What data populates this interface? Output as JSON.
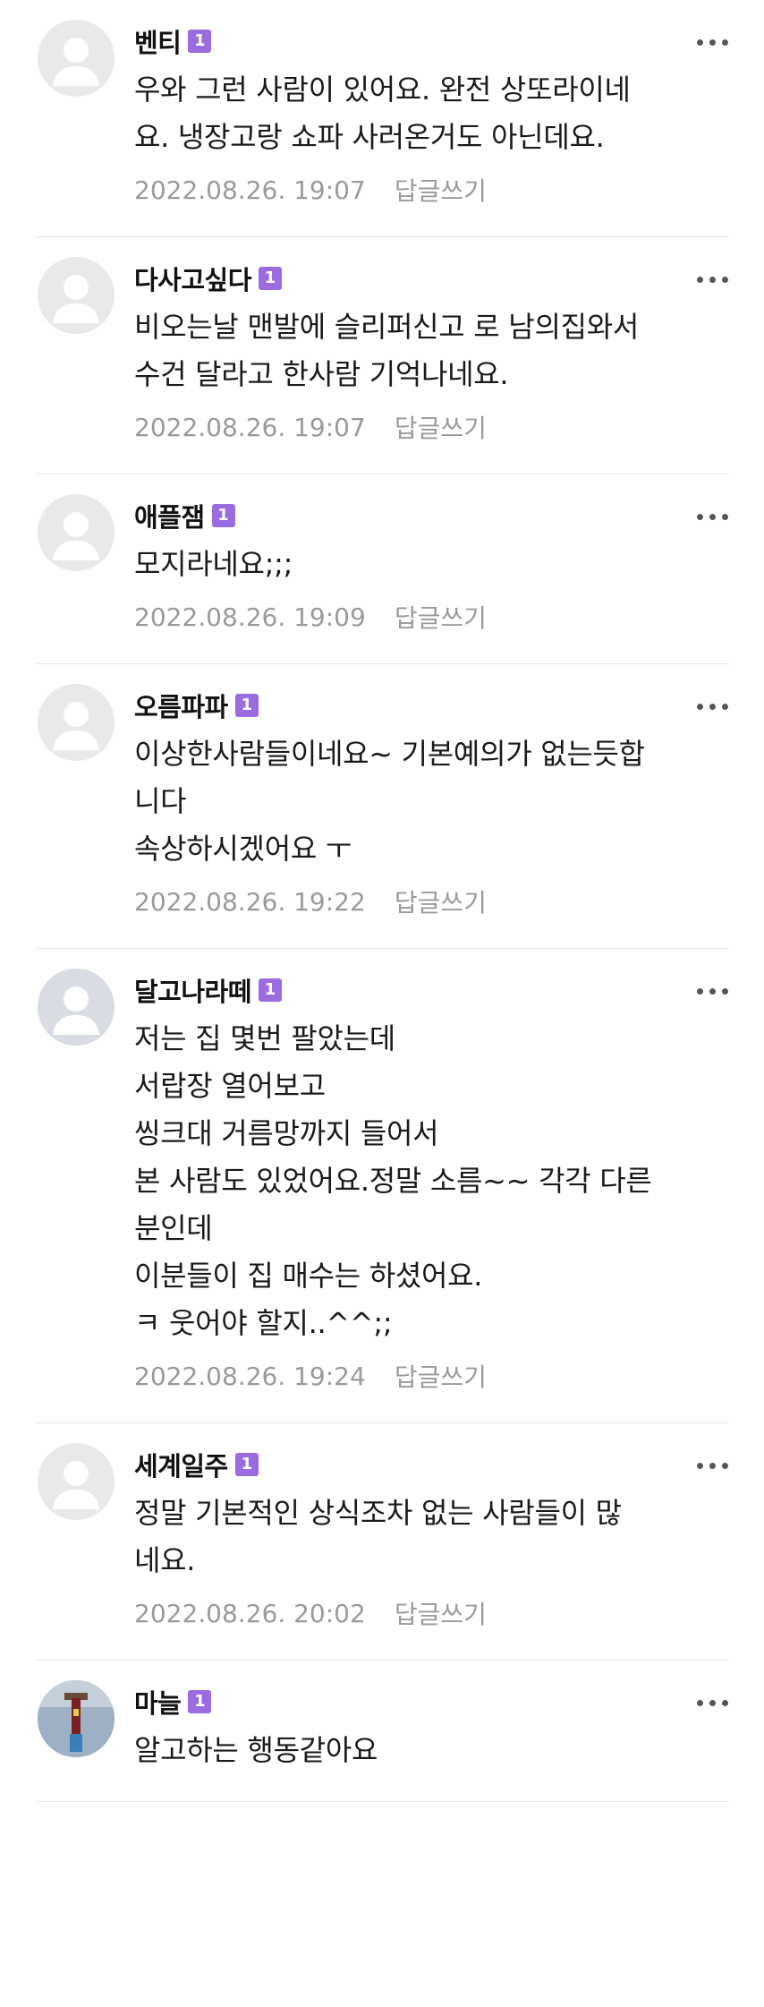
{
  "comments": [
    {
      "author": "벤티",
      "badge": "1",
      "avatar": "default-avatar",
      "lines": [
        "우와 그런 사람이 있어요. 완전 상또라이네",
        "요. 냉장고랑 쇼파 사러온거도 아닌데요."
      ],
      "date": "2022.08.26. 19:07",
      "reply_label": "답글쓰기"
    },
    {
      "author": "다사고싶다",
      "badge": "1",
      "avatar": "default-avatar",
      "lines": [
        "비오는날 맨발에 슬리퍼신고 로 남의집와서",
        "수건 달라고 한사람 기억나네요."
      ],
      "date": "2022.08.26. 19:07",
      "reply_label": "답글쓰기"
    },
    {
      "author": "애플잼",
      "badge": "1",
      "avatar": "default-avatar",
      "lines": [
        "모지라네요;;;"
      ],
      "date": "2022.08.26. 19:09",
      "reply_label": "답글쓰기"
    },
    {
      "author": "오름파파",
      "badge": "1",
      "avatar": "default-avatar",
      "lines": [
        "이상한사람들이네요~ 기본예의가 없는듯합",
        "니다",
        "속상하시겠어요 ㅜ"
      ],
      "date": "2022.08.26. 19:22",
      "reply_label": "답글쓰기"
    },
    {
      "author": "달고나라떼",
      "badge": "1",
      "avatar": "default-avatar-blue",
      "lines": [
        "저는 집 몇번 팔았는데",
        "서랍장 열어보고",
        "씽크대 거름망까지 들어서",
        "본 사람도 있었어요.정말 소름~~ 각각 다른",
        "분인데",
        "이분들이 집 매수는 하셨어요.",
        "ㅋ 웃어야 할지..^^;;"
      ],
      "date": "2022.08.26. 19:24",
      "reply_label": "답글쓰기"
    },
    {
      "author": "세계일주",
      "badge": "1",
      "avatar": "default-avatar",
      "lines": [
        "정말 기본적인 상식조차 없는 사람들이 많",
        "네요."
      ],
      "date": "2022.08.26. 20:02",
      "reply_label": "답글쓰기"
    },
    {
      "author": "마늘",
      "badge": "1",
      "avatar": "photo-avatar",
      "lines": [
        "알고하는 행동같아요"
      ],
      "date": "",
      "reply_label": ""
    }
  ]
}
